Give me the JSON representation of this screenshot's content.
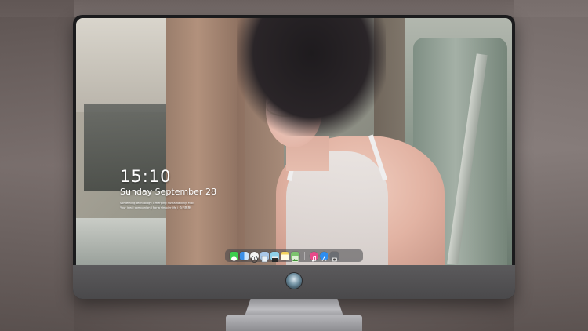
{
  "lock_screen": {
    "time": "15:10",
    "date": "Sunday September 28",
    "info_line_1": "Something technology. Emerging Sustainability. Mac.",
    "info_line_2": "Your ideal companion | For a simpler life | 今日推荐"
  },
  "dock": {
    "apps": [
      {
        "name": "messages",
        "icon": "messages-icon",
        "color": "#3ccf4e"
      },
      {
        "name": "finder",
        "icon": "finder-icon",
        "color": "#3b8fe8"
      },
      {
        "name": "clock",
        "icon": "clock-icon",
        "color": "#f2f2f2"
      },
      {
        "name": "preview",
        "icon": "preview-icon",
        "color": "#a9c7e8"
      },
      {
        "name": "clapper",
        "icon": "clapper-icon",
        "color": "#8fd0ea"
      },
      {
        "name": "notes",
        "icon": "notes-icon",
        "color": "#f4d35e"
      },
      {
        "name": "photos",
        "icon": "photos-icon",
        "color": "#7cc36f"
      },
      {
        "name": "music",
        "icon": "music-icon",
        "color": "#e94a8a"
      },
      {
        "name": "app-store",
        "icon": "app-store-icon",
        "color": "#2e8ef0"
      },
      {
        "name": "camera",
        "icon": "camera-icon",
        "color": "#6b6e73"
      }
    ]
  },
  "monitor": {
    "logo_icon": "brand-logo-icon"
  }
}
